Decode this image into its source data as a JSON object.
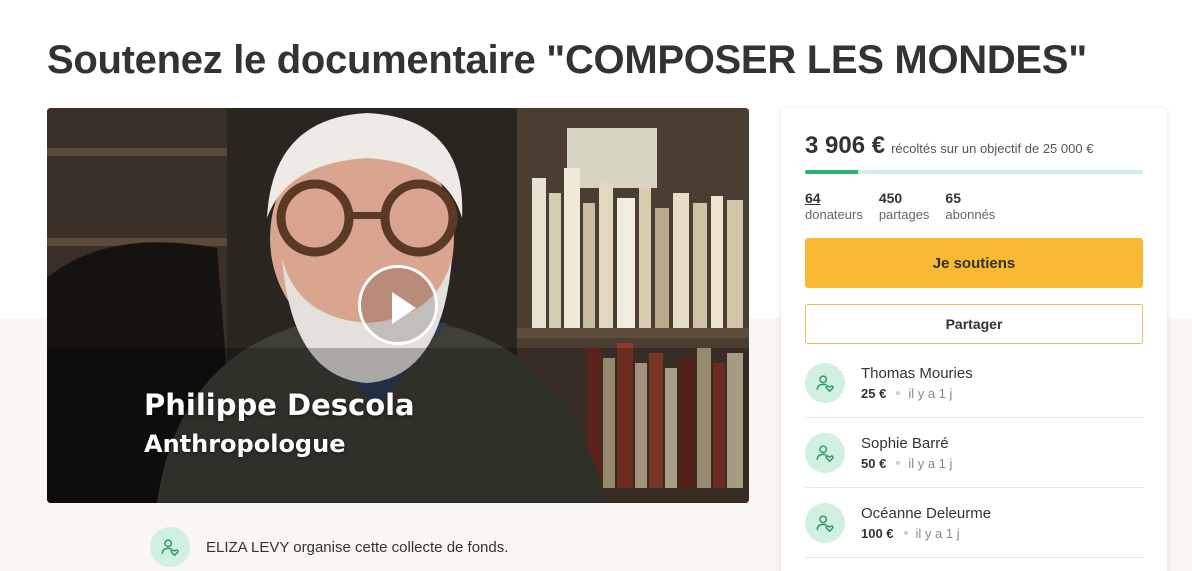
{
  "page": {
    "title": "Soutenez le documentaire \"COMPOSER LES MONDES\""
  },
  "video": {
    "caption_name": "Philippe Descola",
    "caption_role": "Anthropologue"
  },
  "organizer": {
    "text": "ELIZA LEVY organise cette collecte de fonds."
  },
  "campaign": {
    "raised": "3 906 €",
    "goal_text": "récoltés sur un objectif de 25 000 €",
    "progress_fraction": 0.156,
    "stats": [
      {
        "value": "64",
        "label": "donateurs"
      },
      {
        "value": "450",
        "label": "partages"
      },
      {
        "value": "65",
        "label": "abonnés"
      }
    ],
    "support_label": "Je soutiens",
    "share_label": "Partager"
  },
  "donors": [
    {
      "name": "Thomas Mouries",
      "amount": "25 €",
      "time": "il y a 1 j"
    },
    {
      "name": "Sophie Barré",
      "amount": "50 €",
      "time": "il y a 1 j"
    },
    {
      "name": "Océanne Deleurme",
      "amount": "100 €",
      "time": "il y a 1 j"
    }
  ],
  "colors": {
    "accent": "#f9b934",
    "progress": "#2ab26d",
    "progress_track": "#cdeee0",
    "avatar_bg": "#d2f0e0"
  }
}
